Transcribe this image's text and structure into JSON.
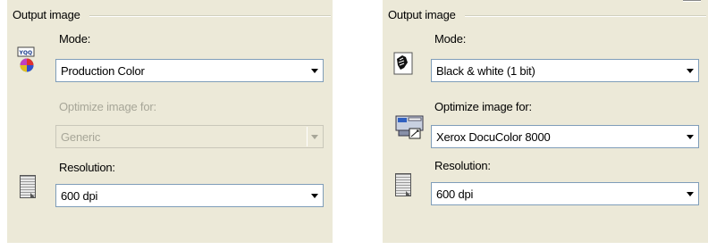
{
  "left": {
    "group_title": "Output image",
    "mode_label": "Mode:",
    "mode_value": "Production Color",
    "mode_icon_text": "YQQ",
    "optimize_label": "Optimize image for:",
    "optimize_value": "Generic",
    "resolution_label": "Resolution:",
    "resolution_value": "600 dpi"
  },
  "right": {
    "group_title": "Output image",
    "mode_label": "Mode:",
    "mode_value": "Black & white (1 bit)",
    "optimize_label": "Optimize image for:",
    "optimize_value": "Xerox DocuColor 8000",
    "resolution_label": "Resolution:",
    "resolution_value": "600 dpi"
  }
}
